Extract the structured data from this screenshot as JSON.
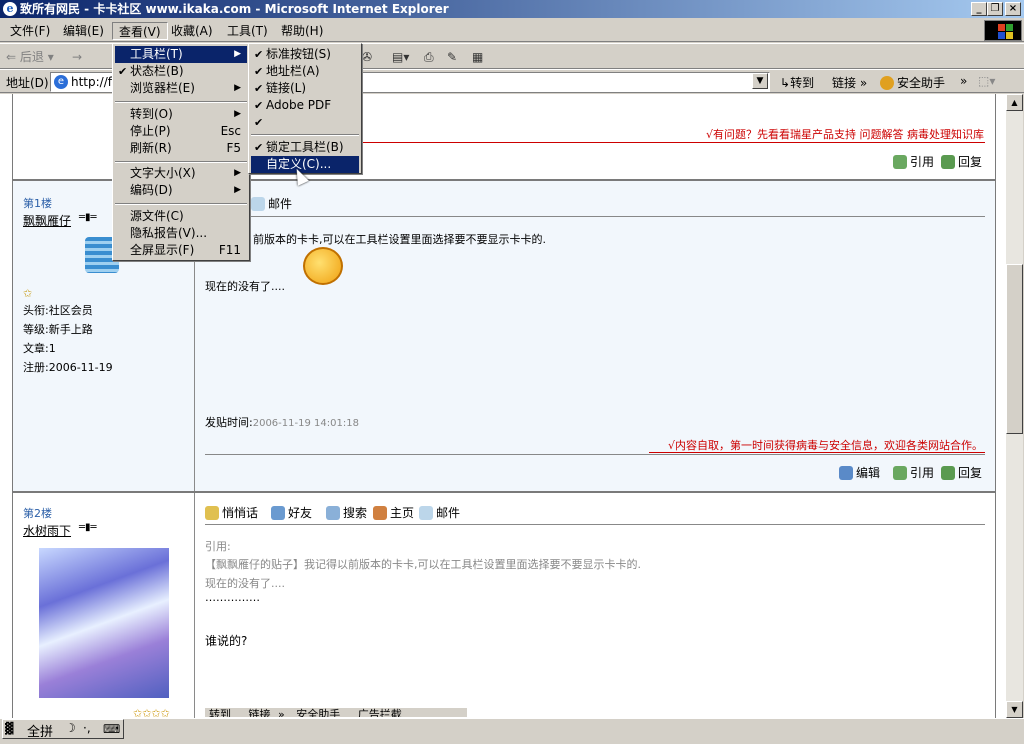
{
  "window": {
    "title": "致所有网民 - 卡卡社区 www.ikaka.com - Microsoft Internet Explorer",
    "icon": "e"
  },
  "menubar": [
    "文件(F)",
    "编辑(E)",
    "查看(V)",
    "收藏(A)",
    "工具(T)",
    "帮助(H)"
  ],
  "toolbar": {
    "back": "后退",
    "forward_arrow": "→"
  },
  "address": {
    "label": "地址(D)",
    "value": "http://fo",
    "go": "转到",
    "links": "链接",
    "links_more": "»",
    "helper": "安全助手",
    "helper_more": "»"
  },
  "view_menu": [
    {
      "label": "工具栏(T)",
      "shortcut": "",
      "submenu": true,
      "checked": false,
      "selected": true
    },
    {
      "label": "状态栏(B)",
      "shortcut": "",
      "submenu": false,
      "checked": true,
      "selected": false
    },
    {
      "label": "浏览器栏(E)",
      "shortcut": "",
      "submenu": true,
      "checked": false,
      "selected": false
    },
    {
      "label": "转到(O)",
      "shortcut": "",
      "submenu": true,
      "checked": false,
      "selected": false
    },
    {
      "label": "停止(P)",
      "shortcut": "Esc",
      "submenu": false,
      "checked": false,
      "selected": false
    },
    {
      "label": "刷新(R)",
      "shortcut": "F5",
      "submenu": false,
      "checked": false,
      "selected": false
    },
    {
      "label": "文字大小(X)",
      "shortcut": "",
      "submenu": true,
      "checked": false,
      "selected": false
    },
    {
      "label": "编码(D)",
      "shortcut": "",
      "submenu": true,
      "checked": false,
      "selected": false
    },
    {
      "label": "源文件(C)",
      "shortcut": "",
      "submenu": false,
      "checked": false,
      "selected": false
    },
    {
      "label": "隐私报告(V)...",
      "shortcut": "",
      "submenu": false,
      "checked": false,
      "selected": false
    },
    {
      "label": "全屏显示(F)",
      "shortcut": "F11",
      "submenu": false,
      "checked": false,
      "selected": false
    }
  ],
  "toolbar_submenu": [
    {
      "label": "标准按钮(S)",
      "checked": true,
      "selected": false
    },
    {
      "label": "地址栏(A)",
      "checked": true,
      "selected": false
    },
    {
      "label": "链接(L)",
      "checked": true,
      "selected": false
    },
    {
      "label": "Adobe PDF",
      "checked": true,
      "selected": false
    },
    {
      "label": "",
      "checked": true,
      "selected": false
    },
    {
      "label": "锁定工具栏(B)",
      "checked": true,
      "selected": false
    },
    {
      "label": "自定义(C)...",
      "checked": false,
      "selected": true
    }
  ],
  "top_banner": {
    "text": "√有问题？先看看瑞星产品支持 问题解答 病毒处理知识库",
    "quote": "引用",
    "reply": "回复"
  },
  "post1": {
    "floor": "第1楼",
    "author": "飘飘雁仔",
    "rank_icon": "star",
    "title_label": "头衔:社区会员",
    "level": "等级:新手上路",
    "posts": "文章:1",
    "reg": "注册:2006-11-19",
    "mail": "邮件",
    "body_line1": "前版本的卡卡,可以在工具栏设置里面选择要不要显示卡卡的.",
    "body_line2": "现在的没有了....",
    "time_label": "发贴时间:",
    "time": "2006-11-19 14:01:18",
    "sig": "√内容自取，第一时间获得病毒与安全信息，欢迎各类网站合作。",
    "edit": "编辑",
    "quote": "引用",
    "reply": "回复"
  },
  "post2": {
    "floor": "第2楼",
    "author": "水树雨下",
    "actions": [
      "悄悄话",
      "好友",
      "搜索",
      "主页",
      "邮件"
    ],
    "quote_label": "引用:",
    "quote_line1": "【飘飘雁仔的贴子】我记得以前版本的卡卡,可以在工具栏设置里面选择要不要显示卡卡的.",
    "quote_line2": "现在的没有了....",
    "quote_dots": "……………",
    "reply_text": "谁说的?",
    "bottom_strip": [
      "转到",
      "链接",
      "»",
      "安全助手",
      "广告拦截"
    ]
  },
  "ime": {
    "label": "全拼"
  }
}
